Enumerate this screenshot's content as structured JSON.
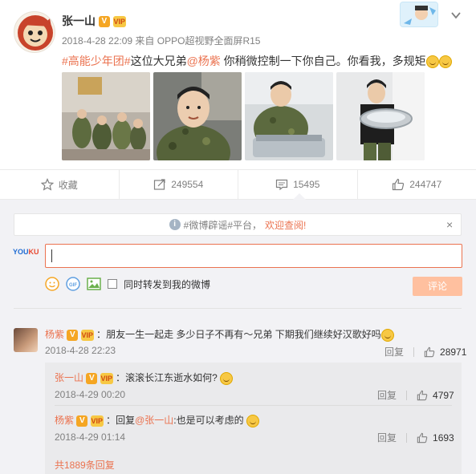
{
  "post": {
    "author": "张一山",
    "verified_badge": "V",
    "vip_badge": "VIP",
    "timestamp": "2018-4-28 22:09",
    "source_prefix": "来自",
    "source_device": "OPPO超视野全面屏R15",
    "tag": "#高能少年团#",
    "text_before_mention": "这位大兄弟",
    "mention": "@杨紫",
    "text_after_mention": " 你稍微控制一下你自己。你看我，多规矩",
    "photos": [
      "photo-group-soldiers",
      "photo-closeup-camo",
      "photo-cooking-pot",
      "photo-washing-basin"
    ]
  },
  "actions": {
    "favorite_label": "收藏",
    "repost_count": "249554",
    "comment_count": "15495",
    "like_count": "244747"
  },
  "notice": {
    "prefix": "#微博辟谣#平台，",
    "link": "欢迎查阅!",
    "close": "×"
  },
  "composer": {
    "youku_a": "YOU",
    "youku_b": "KU",
    "forward_label": "同时转发到我的微博",
    "submit_label": "评论"
  },
  "comment": {
    "author": "杨紫",
    "separator": "：",
    "text": "朋友一生一起走 多少日子不再有～兄弟 下期我们继续好汉歌好吗",
    "time": "2018-4-28 22:23",
    "reply_label": "回复",
    "likes": "28971"
  },
  "replies": [
    {
      "author": "张一山",
      "separator": "：",
      "text": "滚滚长江东逝水如何?",
      "time": "2018-4-29 00:20",
      "reply_label": "回复",
      "likes": "4797"
    },
    {
      "author": "杨紫",
      "separator": "：",
      "reply_prefix": "回复",
      "mention": "@张一山",
      "text": ":也是可以考虑的",
      "time": "2018-4-29 01:14",
      "reply_label": "回复",
      "likes": "1693"
    }
  ],
  "total_replies": "共1889条回复",
  "colors": {
    "accent": "#eb7350",
    "link": "#eb7350",
    "muted": "#808080",
    "comment_bg": "#f2f2f5",
    "submit_disabled": "#ffc09f"
  }
}
